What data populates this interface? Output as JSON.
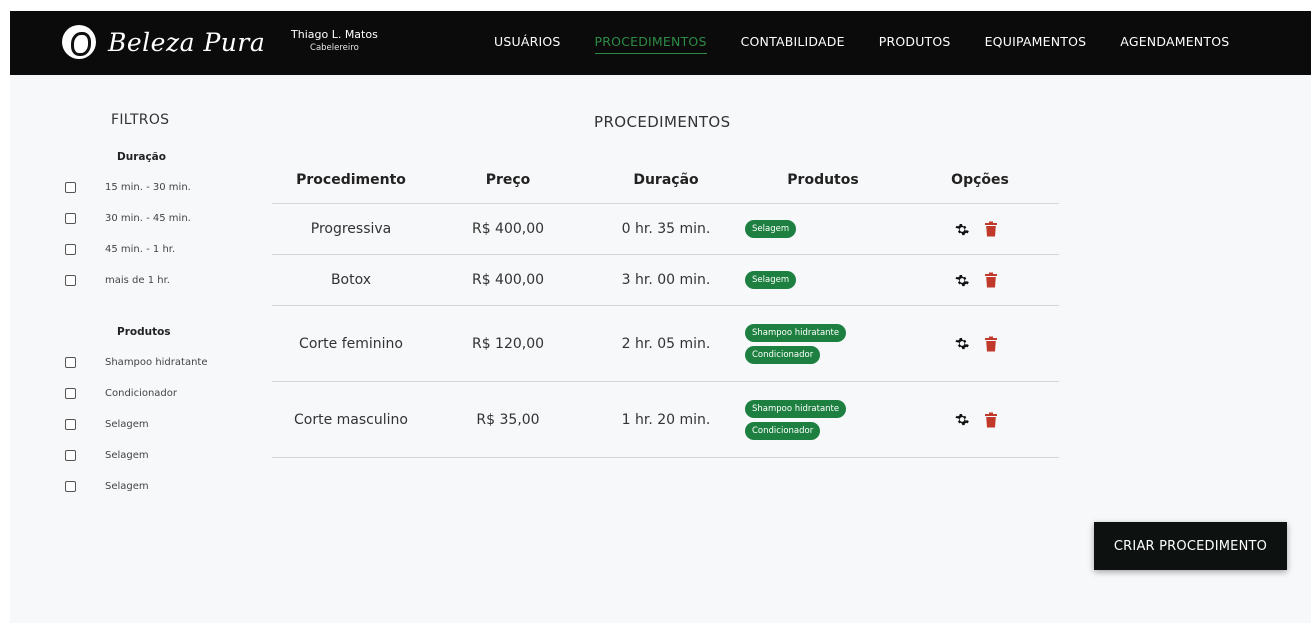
{
  "brand": {
    "name": "Beleza Pura"
  },
  "user": {
    "name": "Thiago L. Matos",
    "role": "Cabelereiro"
  },
  "nav": {
    "items": [
      {
        "label": "USUÁRIOS",
        "active": false
      },
      {
        "label": "PROCEDIMENTOS",
        "active": true
      },
      {
        "label": "CONTABILIDADE",
        "active": false
      },
      {
        "label": "PRODUTOS",
        "active": false
      },
      {
        "label": "EQUIPAMENTOS",
        "active": false
      },
      {
        "label": "AGENDAMENTOS",
        "active": false
      }
    ],
    "active_color": "#2e8b46"
  },
  "filters": {
    "title": "FILTROS",
    "duration": {
      "title": "Duração",
      "options": [
        "15 min. - 30 min.",
        "30 min. - 45 min.",
        "45 min. - 1 hr.",
        "mais de 1 hr."
      ]
    },
    "products": {
      "title": "Produtos",
      "options": [
        "Shampoo hidratante",
        "Condicionador",
        "Selagem",
        "Selagem",
        "Selagem"
      ]
    }
  },
  "main": {
    "title": "PROCEDIMENTOS",
    "columns": [
      "Procedimento",
      "Preço",
      "Duração",
      "Produtos",
      "Opções"
    ],
    "rows": [
      {
        "procedure": "Progressiva",
        "price": "R$ 400,00",
        "duration": "0 hr.  35 min.",
        "products": [
          "Selagem"
        ]
      },
      {
        "procedure": "Botox",
        "price": "R$ 400,00",
        "duration": "3 hr.  00 min.",
        "products": [
          "Selagem"
        ]
      },
      {
        "procedure": "Corte feminino",
        "price": "R$ 120,00",
        "duration": "2 hr.  05 min.",
        "products": [
          "Shampoo hidratante",
          "Condicionador"
        ]
      },
      {
        "procedure": "Corte masculino",
        "price": "R$ 35,00",
        "duration": "1 hr.  20 min.",
        "products": [
          "Shampoo hidratante",
          "Condicionador"
        ]
      }
    ],
    "icons": {
      "edit": "gear-icon",
      "delete": "trash-icon"
    },
    "delete_color": "#c0392b",
    "badge_color": "#1e8040"
  },
  "actions": {
    "create_label": "CRIAR PROCEDIMENTO"
  }
}
